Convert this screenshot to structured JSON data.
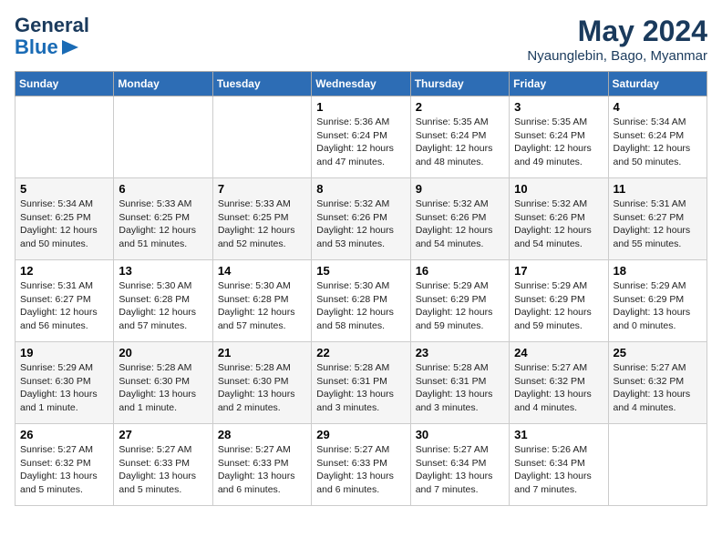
{
  "logo": {
    "line1": "General",
    "line2": "Blue",
    "arrow": true
  },
  "title": {
    "month_year": "May 2024",
    "location": "Nyaunglebin, Bago, Myanmar"
  },
  "headers": [
    "Sunday",
    "Monday",
    "Tuesday",
    "Wednesday",
    "Thursday",
    "Friday",
    "Saturday"
  ],
  "weeks": [
    [
      {
        "day": "",
        "info": ""
      },
      {
        "day": "",
        "info": ""
      },
      {
        "day": "",
        "info": ""
      },
      {
        "day": "1",
        "info": "Sunrise: 5:36 AM\nSunset: 6:24 PM\nDaylight: 12 hours\nand 47 minutes."
      },
      {
        "day": "2",
        "info": "Sunrise: 5:35 AM\nSunset: 6:24 PM\nDaylight: 12 hours\nand 48 minutes."
      },
      {
        "day": "3",
        "info": "Sunrise: 5:35 AM\nSunset: 6:24 PM\nDaylight: 12 hours\nand 49 minutes."
      },
      {
        "day": "4",
        "info": "Sunrise: 5:34 AM\nSunset: 6:24 PM\nDaylight: 12 hours\nand 50 minutes."
      }
    ],
    [
      {
        "day": "5",
        "info": "Sunrise: 5:34 AM\nSunset: 6:25 PM\nDaylight: 12 hours\nand 50 minutes."
      },
      {
        "day": "6",
        "info": "Sunrise: 5:33 AM\nSunset: 6:25 PM\nDaylight: 12 hours\nand 51 minutes."
      },
      {
        "day": "7",
        "info": "Sunrise: 5:33 AM\nSunset: 6:25 PM\nDaylight: 12 hours\nand 52 minutes."
      },
      {
        "day": "8",
        "info": "Sunrise: 5:32 AM\nSunset: 6:26 PM\nDaylight: 12 hours\nand 53 minutes."
      },
      {
        "day": "9",
        "info": "Sunrise: 5:32 AM\nSunset: 6:26 PM\nDaylight: 12 hours\nand 54 minutes."
      },
      {
        "day": "10",
        "info": "Sunrise: 5:32 AM\nSunset: 6:26 PM\nDaylight: 12 hours\nand 54 minutes."
      },
      {
        "day": "11",
        "info": "Sunrise: 5:31 AM\nSunset: 6:27 PM\nDaylight: 12 hours\nand 55 minutes."
      }
    ],
    [
      {
        "day": "12",
        "info": "Sunrise: 5:31 AM\nSunset: 6:27 PM\nDaylight: 12 hours\nand 56 minutes."
      },
      {
        "day": "13",
        "info": "Sunrise: 5:30 AM\nSunset: 6:28 PM\nDaylight: 12 hours\nand 57 minutes."
      },
      {
        "day": "14",
        "info": "Sunrise: 5:30 AM\nSunset: 6:28 PM\nDaylight: 12 hours\nand 57 minutes."
      },
      {
        "day": "15",
        "info": "Sunrise: 5:30 AM\nSunset: 6:28 PM\nDaylight: 12 hours\nand 58 minutes."
      },
      {
        "day": "16",
        "info": "Sunrise: 5:29 AM\nSunset: 6:29 PM\nDaylight: 12 hours\nand 59 minutes."
      },
      {
        "day": "17",
        "info": "Sunrise: 5:29 AM\nSunset: 6:29 PM\nDaylight: 12 hours\nand 59 minutes."
      },
      {
        "day": "18",
        "info": "Sunrise: 5:29 AM\nSunset: 6:29 PM\nDaylight: 13 hours\nand 0 minutes."
      }
    ],
    [
      {
        "day": "19",
        "info": "Sunrise: 5:29 AM\nSunset: 6:30 PM\nDaylight: 13 hours\nand 1 minute."
      },
      {
        "day": "20",
        "info": "Sunrise: 5:28 AM\nSunset: 6:30 PM\nDaylight: 13 hours\nand 1 minute."
      },
      {
        "day": "21",
        "info": "Sunrise: 5:28 AM\nSunset: 6:30 PM\nDaylight: 13 hours\nand 2 minutes."
      },
      {
        "day": "22",
        "info": "Sunrise: 5:28 AM\nSunset: 6:31 PM\nDaylight: 13 hours\nand 3 minutes."
      },
      {
        "day": "23",
        "info": "Sunrise: 5:28 AM\nSunset: 6:31 PM\nDaylight: 13 hours\nand 3 minutes."
      },
      {
        "day": "24",
        "info": "Sunrise: 5:27 AM\nSunset: 6:32 PM\nDaylight: 13 hours\nand 4 minutes."
      },
      {
        "day": "25",
        "info": "Sunrise: 5:27 AM\nSunset: 6:32 PM\nDaylight: 13 hours\nand 4 minutes."
      }
    ],
    [
      {
        "day": "26",
        "info": "Sunrise: 5:27 AM\nSunset: 6:32 PM\nDaylight: 13 hours\nand 5 minutes."
      },
      {
        "day": "27",
        "info": "Sunrise: 5:27 AM\nSunset: 6:33 PM\nDaylight: 13 hours\nand 5 minutes."
      },
      {
        "day": "28",
        "info": "Sunrise: 5:27 AM\nSunset: 6:33 PM\nDaylight: 13 hours\nand 6 minutes."
      },
      {
        "day": "29",
        "info": "Sunrise: 5:27 AM\nSunset: 6:33 PM\nDaylight: 13 hours\nand 6 minutes."
      },
      {
        "day": "30",
        "info": "Sunrise: 5:27 AM\nSunset: 6:34 PM\nDaylight: 13 hours\nand 7 minutes."
      },
      {
        "day": "31",
        "info": "Sunrise: 5:26 AM\nSunset: 6:34 PM\nDaylight: 13 hours\nand 7 minutes."
      },
      {
        "day": "",
        "info": ""
      }
    ]
  ]
}
